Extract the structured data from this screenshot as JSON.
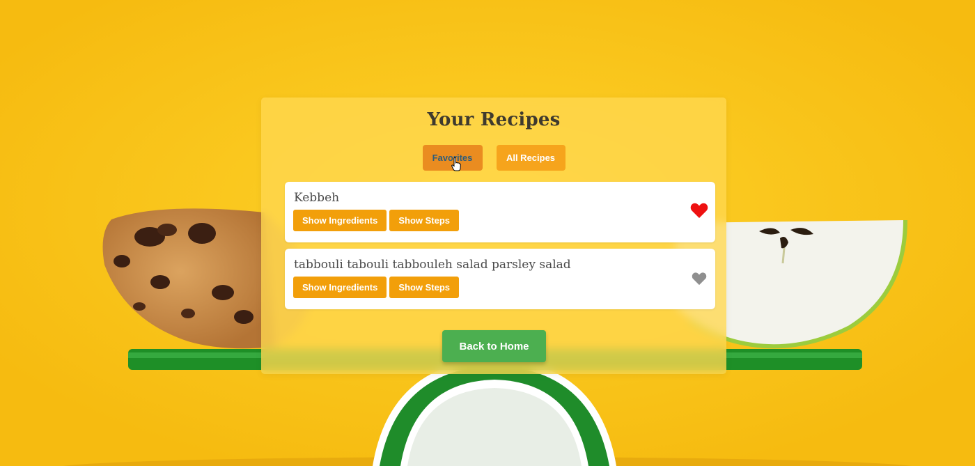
{
  "page": {
    "title": "Your Recipes"
  },
  "filters": {
    "favorites_label": "Favorites",
    "all_label": "All Recipes",
    "active": "Favorites"
  },
  "recipes": [
    {
      "name": "Kebbeh",
      "ingredients_label": "Show Ingredients",
      "steps_label": "Show Steps",
      "favorite": true
    },
    {
      "name": "tabbouli tabouli tabbouleh salad parsley salad",
      "ingredients_label": "Show Ingredients",
      "steps_label": "Show Steps",
      "favorite": false
    }
  ],
  "footer": {
    "back_label": "Back to Home"
  },
  "colors": {
    "background": "#f9c416",
    "filter_button": "#f6a41c",
    "small_button": "#f29f0a",
    "back_button": "#4caf50",
    "heart_favorite": "#ee1111",
    "heart_default": "#8f8f8f"
  },
  "icons": {
    "favorite": "heart-icon",
    "cursor": "hand-pointer-cursor"
  }
}
